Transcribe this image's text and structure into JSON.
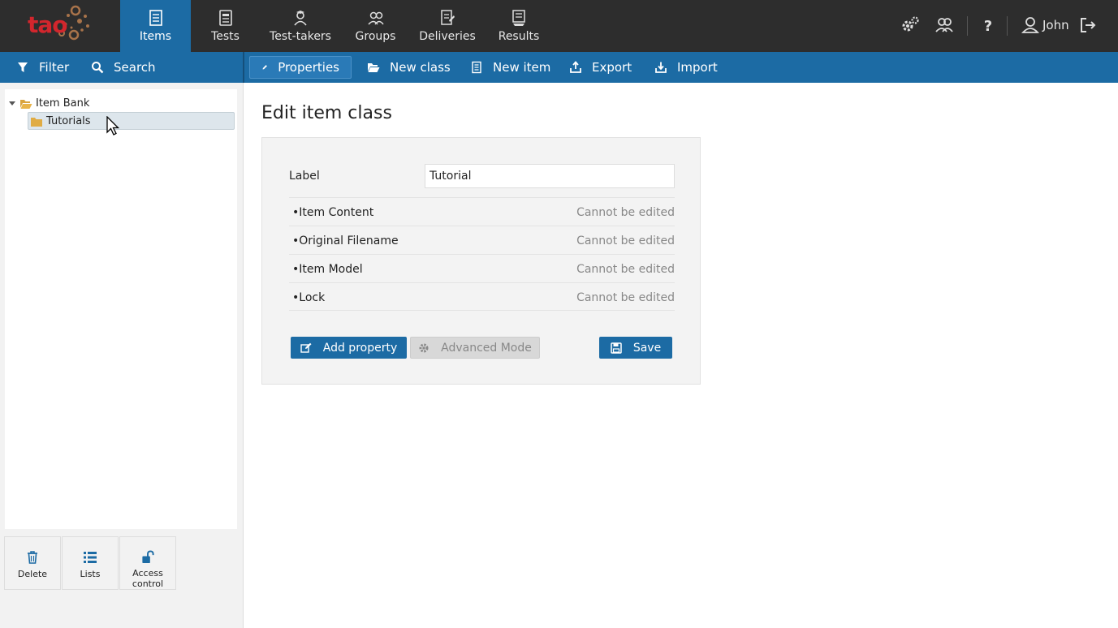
{
  "brand": {
    "logo_text": "tao",
    "accent": "#1c6ba4",
    "logo_red": "#d2262d"
  },
  "topnav": {
    "items": [
      {
        "label": "Items",
        "icon": "items-icon",
        "active": true
      },
      {
        "label": "Tests",
        "icon": "tests-icon",
        "active": false
      },
      {
        "label": "Test-takers",
        "icon": "test-takers-icon",
        "active": false
      },
      {
        "label": "Groups",
        "icon": "groups-icon",
        "active": false
      },
      {
        "label": "Deliveries",
        "icon": "deliveries-icon",
        "active": false
      },
      {
        "label": "Results",
        "icon": "results-icon",
        "active": false
      }
    ],
    "tools": [
      "settings-icon",
      "users-icon",
      "help-icon",
      "user-icon",
      "logout-icon"
    ],
    "user_name": "John"
  },
  "sidebar_actions": {
    "filter_label": "Filter",
    "search_label": "Search"
  },
  "actions": [
    {
      "label": "Properties",
      "icon": "pencil-icon",
      "active": true
    },
    {
      "label": "New class",
      "icon": "folder-open-icon",
      "active": false
    },
    {
      "label": "New item",
      "icon": "item-icon",
      "active": false
    },
    {
      "label": "Export",
      "icon": "export-icon",
      "active": false
    },
    {
      "label": "Import",
      "icon": "import-icon",
      "active": false
    }
  ],
  "tree": {
    "root": "Item Bank",
    "children": [
      "Tutorials"
    ],
    "selected": "Tutorials"
  },
  "bottom_buttons": [
    {
      "label": "Delete",
      "icon": "trash-icon"
    },
    {
      "label": "Lists",
      "icon": "list-icon"
    },
    {
      "label": "Access control",
      "icon": "unlock-icon"
    }
  ],
  "main": {
    "title": "Edit item class",
    "label_field": {
      "label": "Label",
      "value": "Tutorial"
    },
    "properties": [
      {
        "name": "Item Content",
        "status": "Cannot be edited"
      },
      {
        "name": "Original Filename",
        "status": "Cannot be edited"
      },
      {
        "name": "Item Model",
        "status": "Cannot be edited"
      },
      {
        "name": "Lock",
        "status": "Cannot be edited"
      }
    ],
    "buttons": {
      "add_property": "Add property",
      "advanced_mode": "Advanced Mode",
      "save": "Save"
    }
  }
}
